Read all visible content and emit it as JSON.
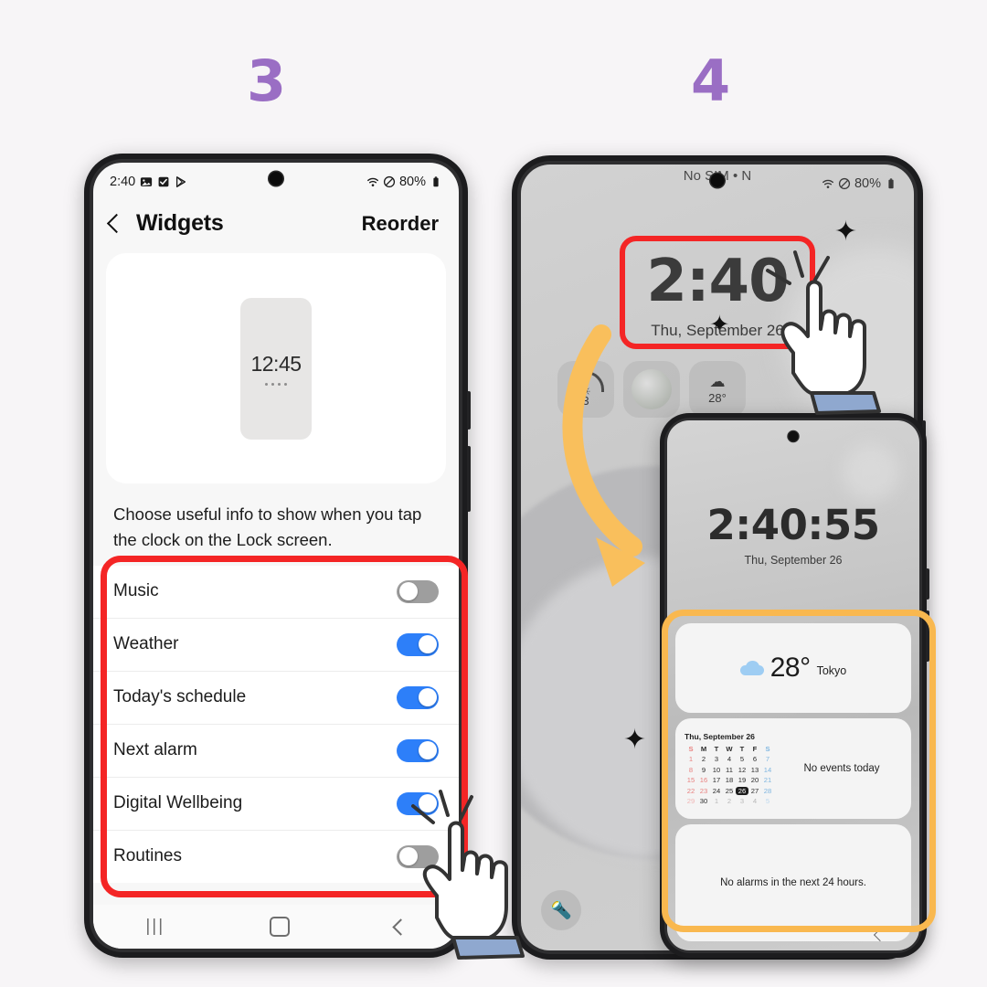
{
  "steps": {
    "three": "3",
    "four": "4"
  },
  "phone_left": {
    "status_bar": {
      "time": "2:40",
      "icons": [
        "image-icon",
        "checkbox-icon",
        "play-store-icon"
      ],
      "wifi": "wifi-icon",
      "mute": "mute-icon",
      "battery_text": "80%",
      "battery": "battery-icon"
    },
    "app_bar": {
      "back": "back-chevron-icon",
      "title": "Widgets",
      "action": "Reorder"
    },
    "preview": {
      "widget_time": "12:45",
      "dots": 4
    },
    "helper_text": "Choose useful info to show when you tap the clock on the Lock screen.",
    "settings": [
      {
        "label": "Music",
        "state": "off"
      },
      {
        "label": "Weather",
        "state": "on"
      },
      {
        "label": "Today's schedule",
        "state": "on"
      },
      {
        "label": "Next alarm",
        "state": "on"
      },
      {
        "label": "Digital Wellbeing",
        "state": "on"
      },
      {
        "label": "Routines",
        "state": "off"
      }
    ],
    "nav_bar": {
      "recents": "|||",
      "home": "home-icon",
      "back": "back-icon"
    }
  },
  "phone_right": {
    "status_bar": {
      "carrier": "No SIM • N",
      "wifi": "wifi-icon",
      "mute": "mute-icon",
      "battery_text": "80%",
      "battery": "battery-icon"
    },
    "lock": {
      "time": "2:40",
      "date": "Thu, September 26",
      "shortcuts": [
        {
          "name": "uv-index-widget",
          "value": "3"
        },
        {
          "name": "moon-phase-widget",
          "value": ""
        },
        {
          "name": "weather-widget",
          "value": "28°"
        }
      ],
      "flashlight": "flashlight-icon"
    }
  },
  "phone_inner": {
    "clock": {
      "time": "2:40:55",
      "date": "Thu, September 26"
    },
    "weather_widget": {
      "icon": "cloud-icon",
      "temp": "28°",
      "city": "Tokyo"
    },
    "calendar_widget": {
      "title": "Thu, September 26",
      "weekday_headers": [
        "S",
        "M",
        "T",
        "W",
        "T",
        "F",
        "S"
      ],
      "weeks": [
        [
          "",
          "",
          "",
          "",
          "",
          "",
          ""
        ],
        [
          "1",
          "2",
          "3",
          "4",
          "5",
          "6",
          "7"
        ],
        [
          "8",
          "9",
          "10",
          "11",
          "12",
          "13",
          "14"
        ],
        [
          "15",
          "16",
          "17",
          "18",
          "19",
          "20",
          "21"
        ],
        [
          "22",
          "23",
          "24",
          "25",
          "26",
          "27",
          "28"
        ],
        [
          "29",
          "30",
          "1",
          "2",
          "3",
          "4",
          "5"
        ]
      ],
      "today": "26",
      "events_text": "No events today"
    },
    "alarm_widget": {
      "text": "No alarms in the next 24 hours."
    },
    "nav_back": "back-icon"
  },
  "annotations": {
    "red_box_left": "highlight-settings-list",
    "red_box_right": "highlight-lock-clock",
    "orange_box": "highlight-widget-stack",
    "arrow": "orange-curved-arrow",
    "hand_left": "tap-hand-cursor",
    "hand_right": "tap-hand-cursor"
  },
  "colors": {
    "accent_purple": "#9a6ec4",
    "highlight_red": "#f42525",
    "highlight_orange": "#f9b84f",
    "toggle_on": "#2d7ff9",
    "toggle_off": "#9e9e9e",
    "page_bg": "#f7f5f7"
  }
}
